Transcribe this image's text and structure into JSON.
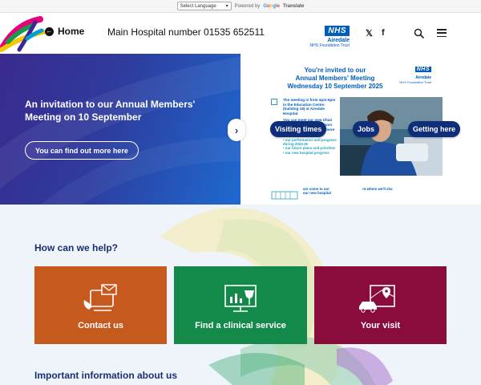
{
  "translate": {
    "select_label": "Select Language",
    "powered_by": "Powered by",
    "google": "Google",
    "translate_word": "Translate"
  },
  "header": {
    "home_label": "Home",
    "phone_text": "Main Hospital number 01535 652511",
    "nhs_badge": "NHS",
    "nhs_org": "Airedale",
    "nhs_trust": "NHS Foundation Trust",
    "x_icon": "𝕏",
    "facebook_icon": "f"
  },
  "hero": {
    "title": "An invitation to our Annual Members' Meeting on 10 September",
    "button_label": "You can find out more here",
    "next_arrow": "›"
  },
  "poster": {
    "nhs_badge": "NHS",
    "nhs_org": "Airedale",
    "nhs_trust": "NHS Foundation Trust",
    "invite_line1": "You're invited to our",
    "invite_line2": "Annual Members' Meeting",
    "invite_line3": "Wednesday 10 September 2025",
    "details": "The meeting is from 4pm-6pm in the Education Centre (building 18) at Airedale Hospital.",
    "meet_text": "You can meet our new Chair John Lawlor, our Governors and our Board and hear more about:",
    "list": [
      "our performance and progress during 2024-25",
      "our future plans and priorities",
      "our new hospital progress"
    ],
    "welcome_text": "are come to our",
    "welcome_text2": "nt where we'll sha",
    "welcome_text3": "our new hospital"
  },
  "quick_links": [
    {
      "label": "Visiting times"
    },
    {
      "label": "Jobs"
    },
    {
      "label": "Getting here"
    }
  ],
  "help": {
    "title": "How can we help?",
    "cards": [
      {
        "label": "Contact us",
        "color": "#c65a1e",
        "icon": "contact-icon"
      },
      {
        "label": "Find a clinical service",
        "color": "#138a4a",
        "icon": "clinical-service-icon"
      },
      {
        "label": "Your visit",
        "color": "#8a0c3c",
        "icon": "visit-icon"
      }
    ]
  },
  "info": {
    "title": "Important information about us"
  },
  "colors": {
    "nhs_blue": "#005eb8",
    "navy": "#1a3070",
    "pill_navy": "#0e2e7a"
  }
}
